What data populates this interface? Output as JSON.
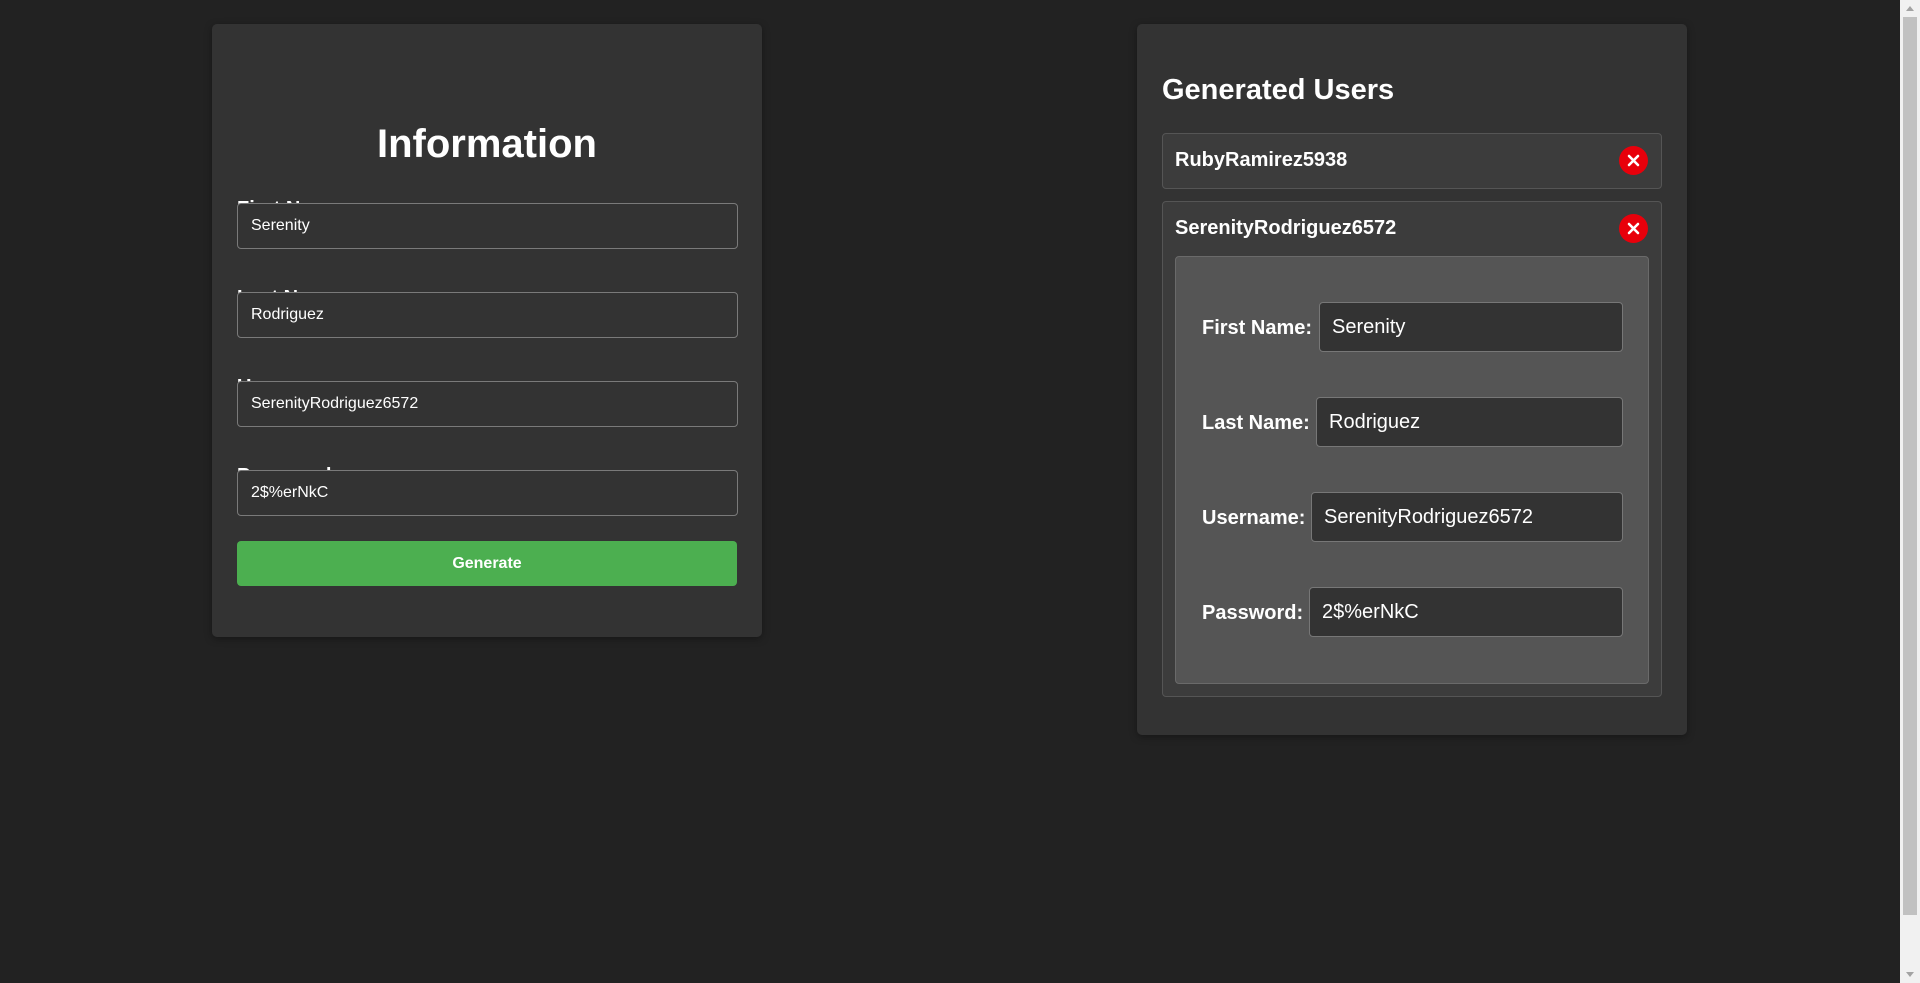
{
  "information_form": {
    "title": "Information",
    "first_name": {
      "label": "First Name:",
      "value": "Serenity"
    },
    "last_name": {
      "label": "Last Name:",
      "value": "Rodriguez"
    },
    "username": {
      "label": "Username:",
      "value": "SerenityRodriguez6572"
    },
    "password": {
      "label": "Password:",
      "value": "2$%erNkC"
    },
    "generate_label": "Generate"
  },
  "generated_users": {
    "title": "Generated Users",
    "users": [
      {
        "username": "RubyRamirez5938",
        "expanded": false
      },
      {
        "username": "SerenityRodriguez6572",
        "expanded": true,
        "details": {
          "first_name": {
            "label": "First Name:",
            "value": "Serenity"
          },
          "last_name": {
            "label": "Last Name:",
            "value": "Rodriguez"
          },
          "username": {
            "label": "Username:",
            "value": "SerenityRodriguez6572"
          },
          "password": {
            "label": "Password:",
            "value": "2$%erNkC"
          }
        }
      }
    ],
    "delete_icon": "close-icon"
  },
  "colors": {
    "background": "#222222",
    "panel": "#333333",
    "accent_green": "#4caf50",
    "delete_red": "#e8000b"
  }
}
